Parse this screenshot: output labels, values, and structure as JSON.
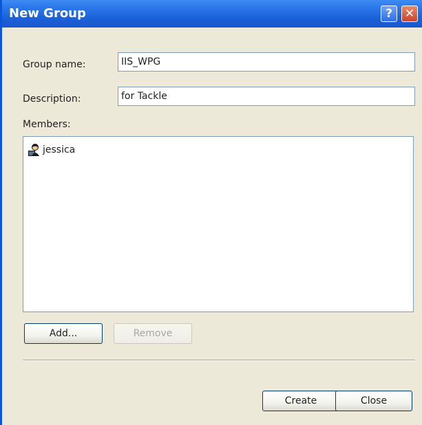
{
  "window": {
    "title": "New Group",
    "help_label": "?",
    "close_label": "✕"
  },
  "form": {
    "group_name_label": "Group name:",
    "group_name_value": "IIS_WPG",
    "description_label": "Description:",
    "description_value": "for Tackle",
    "members_label": "Members:"
  },
  "members": [
    {
      "name": "jessica",
      "icon": "user-icon"
    }
  ],
  "buttons": {
    "add": "Add...",
    "remove": "Remove",
    "create": "Create",
    "close": "Close"
  },
  "colors": {
    "titlebar": "#2a76ea",
    "dialog_bg": "#ece9d8",
    "input_border": "#7f9db9"
  }
}
